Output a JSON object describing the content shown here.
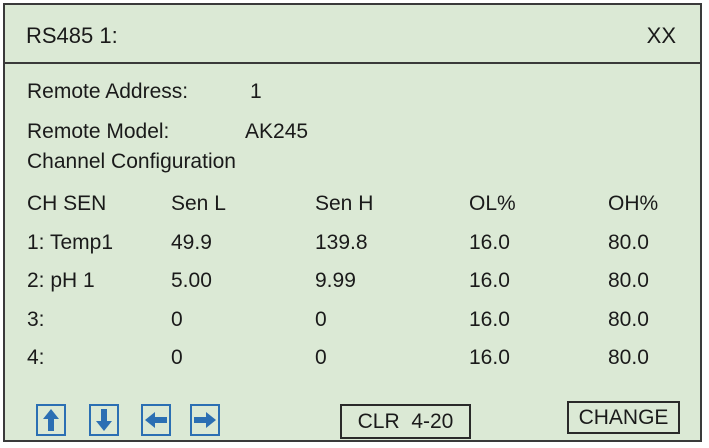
{
  "header": {
    "title": "RS485 1:",
    "status": "XX"
  },
  "info": {
    "address_label": "Remote Address:",
    "address_value": "1",
    "model_label": "Remote Model:",
    "model_value": "AK245",
    "section_title": "Channel Configuration"
  },
  "table": {
    "headers": [
      "CH SEN",
      "Sen L",
      "Sen H",
      "OL%",
      "OH%"
    ],
    "rows": [
      [
        "1: Temp1",
        "49.9",
        "139.8",
        "16.0",
        "80.0"
      ],
      [
        "2: pH 1",
        "5.00",
        "9.99",
        "16.0",
        "80.0"
      ],
      [
        "3:",
        "0",
        "0",
        "16.0",
        "80.0"
      ],
      [
        "4:",
        "0",
        "0",
        "16.0",
        "80.0"
      ]
    ]
  },
  "buttons": {
    "up": "arrow-up-icon",
    "down": "arrow-down-icon",
    "left": "arrow-left-icon",
    "right": "arrow-right-icon",
    "clr_label": "CLR  4-20",
    "change_label": "CHANGE"
  },
  "colors": {
    "panel_bg": "#dbe9d5",
    "arrow_blue": "#2b6fb3",
    "border": "#3a3a3a"
  }
}
